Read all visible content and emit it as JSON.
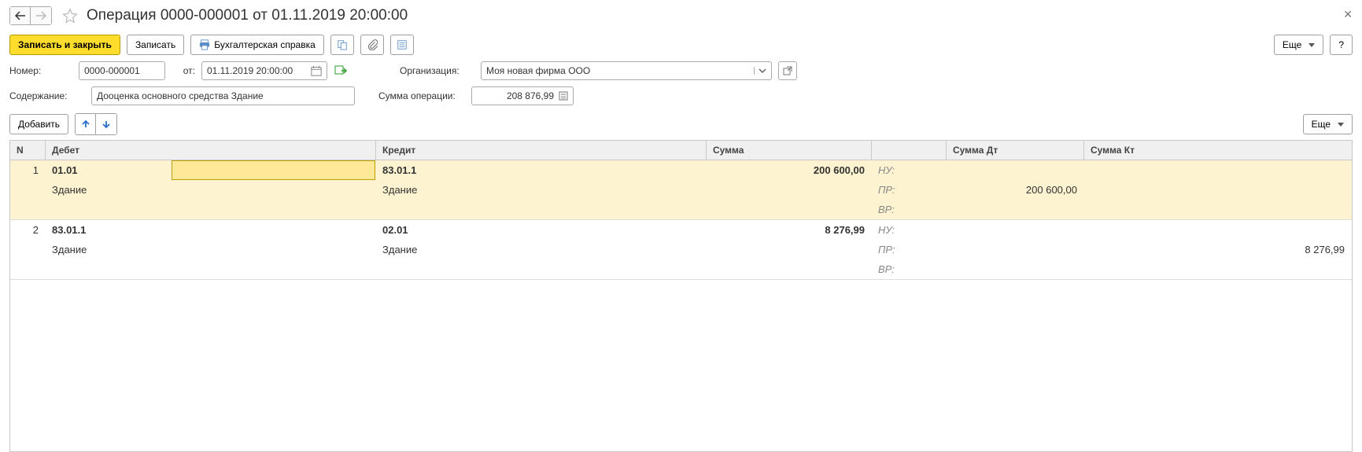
{
  "header": {
    "title": "Операция 0000-000001 от 01.11.2019 20:00:00"
  },
  "toolbar": {
    "save_close": "Записать и закрыть",
    "save": "Записать",
    "report": "Бухгалтерская справка",
    "more": "Еще",
    "help": "?"
  },
  "form": {
    "number_label": "Номер:",
    "number_value": "0000-000001",
    "from_label": "от:",
    "date_value": "01.11.2019 20:00:00",
    "org_label": "Организация:",
    "org_value": "Моя новая фирма ООО",
    "content_label": "Содержание:",
    "content_value": "Дооценка основного средства Здание",
    "opsum_label": "Сумма операции:",
    "opsum_value": "208 876,99"
  },
  "tb2": {
    "add": "Добавить",
    "more": "Еще"
  },
  "columns": {
    "n": "N",
    "debit": "Дебет",
    "credit": "Кредит",
    "sum": "Сумма",
    "sumdt": "Сумма Дт",
    "sumkt": "Сумма Кт"
  },
  "labels": {
    "nu": "НУ:",
    "pr": "ПР:",
    "vr": "ВР:"
  },
  "rows": [
    {
      "n": "1",
      "debit_code": "01.01",
      "debit_sub": "Здание",
      "credit_code": "83.01.1",
      "credit_sub": "Здание",
      "sum": "200 600,00",
      "pr_dt": "200 600,00",
      "pr_kt": "",
      "highlight": true
    },
    {
      "n": "2",
      "debit_code": "83.01.1",
      "debit_sub": "Здание",
      "credit_code": "02.01",
      "credit_sub": "Здание",
      "sum": "8 276,99",
      "pr_dt": "",
      "pr_kt": "8 276,99",
      "highlight": false
    }
  ]
}
